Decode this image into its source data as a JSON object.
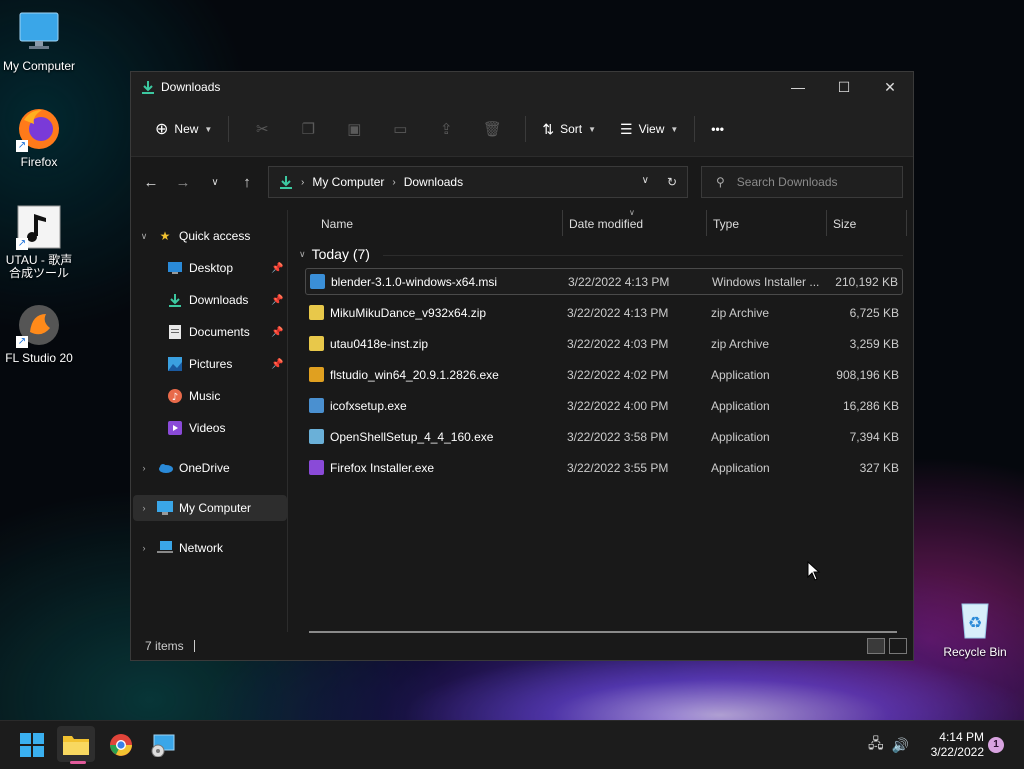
{
  "desktop": {
    "icons": [
      {
        "label": "My Computer"
      },
      {
        "label": "Firefox"
      },
      {
        "label": "UTAU - 歌声\n合成ツール"
      },
      {
        "label": "FL Studio 20"
      },
      {
        "label": "Recycle Bin"
      }
    ]
  },
  "window": {
    "title": "Downloads",
    "controls": {
      "minimize": "—",
      "maximize": "☐",
      "close": "✕"
    }
  },
  "command_bar": {
    "new_label": "New",
    "sort_label": "Sort",
    "view_label": "View",
    "more_label": "•••"
  },
  "address_bar": {
    "crumbs": [
      "My Computer",
      "Downloads"
    ]
  },
  "search": {
    "placeholder": "Search Downloads"
  },
  "sidebar": {
    "quick_access": "Quick access",
    "items": [
      {
        "label": "Desktop",
        "icon": "desktop-icon",
        "pinned": true
      },
      {
        "label": "Downloads",
        "icon": "download-icon",
        "pinned": true
      },
      {
        "label": "Documents",
        "icon": "document-icon",
        "pinned": true
      },
      {
        "label": "Pictures",
        "icon": "picture-icon",
        "pinned": true
      },
      {
        "label": "Music",
        "icon": "music-icon",
        "pinned": false
      },
      {
        "label": "Videos",
        "icon": "video-icon",
        "pinned": false
      }
    ],
    "onedrive": "OneDrive",
    "my_computer": "My Computer",
    "network": "Network"
  },
  "columns": {
    "name": "Name",
    "date": "Date modified",
    "type": "Type",
    "size": "Size"
  },
  "group": {
    "label": "Today (7)"
  },
  "files": [
    {
      "name": "blender-3.1.0-windows-x64.msi",
      "date": "3/22/2022 4:13 PM",
      "type": "Windows Installer ...",
      "size": "210,192 KB",
      "icon": "msi-icon",
      "color": "#3a8fd8"
    },
    {
      "name": "MikuMikuDance_v932x64.zip",
      "date": "3/22/2022 4:13 PM",
      "type": "zip Archive",
      "size": "6,725 KB",
      "icon": "zip-icon",
      "color": "#e8c84a"
    },
    {
      "name": "utau0418e-inst.zip",
      "date": "3/22/2022 4:03 PM",
      "type": "zip Archive",
      "size": "3,259 KB",
      "icon": "zip-icon",
      "color": "#e8c84a"
    },
    {
      "name": "flstudio_win64_20.9.1.2826.exe",
      "date": "3/22/2022 4:02 PM",
      "type": "Application",
      "size": "908,196 KB",
      "icon": "installer-icon",
      "color": "#e0a020"
    },
    {
      "name": "icofxsetup.exe",
      "date": "3/22/2022 4:00 PM",
      "type": "Application",
      "size": "16,286 KB",
      "icon": "setup-icon",
      "color": "#4a90d0"
    },
    {
      "name": "OpenShellSetup_4_4_160.exe",
      "date": "3/22/2022 3:58 PM",
      "type": "Application",
      "size": "7,394 KB",
      "icon": "shell-icon",
      "color": "#6ab0d8"
    },
    {
      "name": "Firefox Installer.exe",
      "date": "3/22/2022 3:55 PM",
      "type": "Application",
      "size": "327 KB",
      "icon": "firefox-icon",
      "color": "#8a4ad8"
    }
  ],
  "status": {
    "count": "7 items"
  },
  "taskbar": {
    "time": "4:14 PM",
    "date": "3/22/2022",
    "notification_count": "1"
  }
}
